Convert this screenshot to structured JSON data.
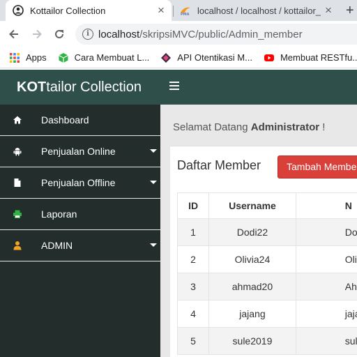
{
  "browser": {
    "tabs": [
      {
        "title": "Kottailor Collection",
        "active": true,
        "close": "×"
      },
      {
        "title": "localhost / localhost / kottailor_",
        "active": false,
        "close": "×"
      }
    ],
    "new_tab": "+",
    "url_host": "localhost",
    "url_path": "/skripsiMVC/public/Admin_member",
    "bookmarks": [
      {
        "label": "Apps",
        "icon": "apps-grid-icon"
      },
      {
        "label": "Cara Membuat L...",
        "icon": "green-cube-icon"
      },
      {
        "label": "API Otentikasi M...",
        "icon": "dark-diamond-icon"
      },
      {
        "label": "Membuat RESTfu...",
        "icon": "youtube-icon"
      }
    ]
  },
  "header": {
    "brand_bold": "KOT",
    "brand_rest": "tailor Collection",
    "color": "#2f4f4a"
  },
  "sidebar": {
    "items": [
      {
        "label": "Dashboard",
        "icon": "home-icon",
        "has_caret": false
      },
      {
        "label": "Penjualan Online",
        "icon": "android-icon",
        "has_caret": true
      },
      {
        "label": "Penjualan Offline",
        "icon": "file-icon",
        "has_caret": true
      },
      {
        "label": "Laporan",
        "icon": "printer-icon",
        "has_caret": false
      },
      {
        "label": "ADMIN",
        "icon": "user-icon",
        "has_caret": true
      }
    ]
  },
  "main": {
    "welcome_prefix": "Selamat Datang ",
    "welcome_user": "Administrator",
    "welcome_suffix": " !",
    "card_title": "Daftar Member",
    "add_button": "Tambah Member",
    "table": {
      "headers": [
        "ID",
        "Username",
        "N"
      ],
      "rows": [
        {
          "id": "1",
          "username": "Dodi22",
          "name": "Do"
        },
        {
          "id": "2",
          "username": "Olivia24",
          "name": "Olivia"
        },
        {
          "id": "3",
          "username": "ahmad20",
          "name": "Ahm"
        },
        {
          "id": "4",
          "username": "jajang",
          "name": "jajang"
        },
        {
          "id": "5",
          "username": "sule2019",
          "name": "sule"
        }
      ]
    }
  }
}
